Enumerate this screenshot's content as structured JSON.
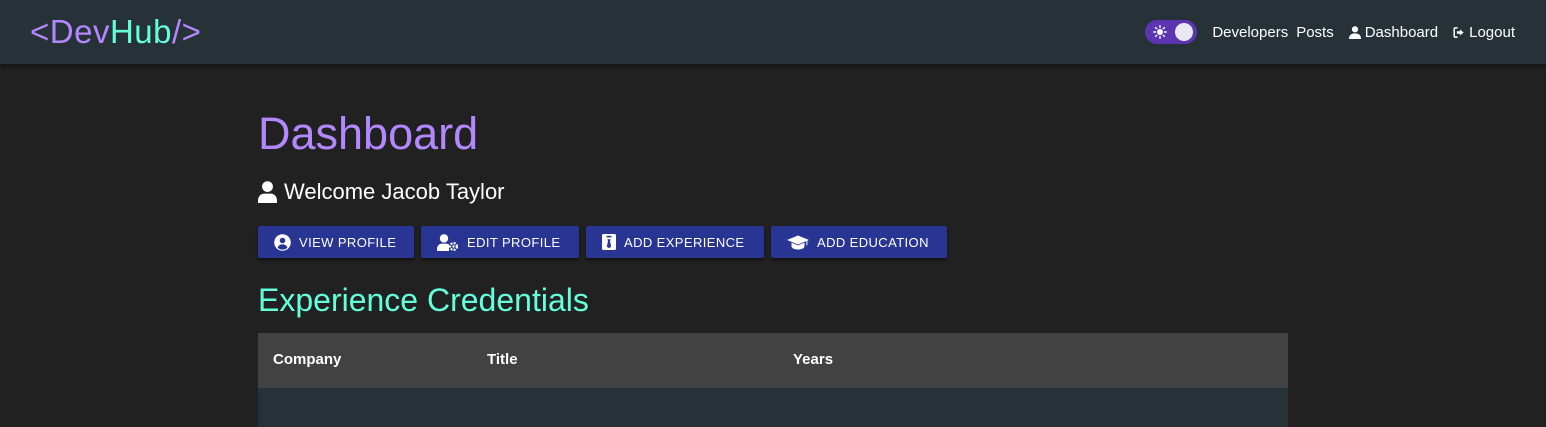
{
  "navbar": {
    "brand": {
      "open_bracket": "<",
      "dev": "Dev",
      "hub": "Hub",
      "close_bracket": "/>"
    },
    "theme_toggle": {
      "icon": "sun-icon",
      "state": "on"
    },
    "links": {
      "developers": "Developers",
      "posts": "Posts",
      "dashboard": "Dashboard",
      "logout": "Logout"
    }
  },
  "main": {
    "title": "Dashboard",
    "welcome": "Welcome Jacob Taylor",
    "actions": {
      "view_profile": "VIEW PROFILE",
      "edit_profile": "EDIT PROFILE",
      "add_experience": "ADD EXPERIENCE",
      "add_education": "ADD EDUCATION"
    },
    "experience": {
      "heading": "Experience Credentials",
      "columns": {
        "company": "Company",
        "title": "Title",
        "years": "Years"
      }
    }
  },
  "colors": {
    "background": "#212121",
    "navbar": "#263238",
    "accent_purple": "#b388ff",
    "accent_teal": "#64ffda",
    "button": "#283593",
    "toggle": "#5e35b1",
    "table_header": "#424242"
  }
}
